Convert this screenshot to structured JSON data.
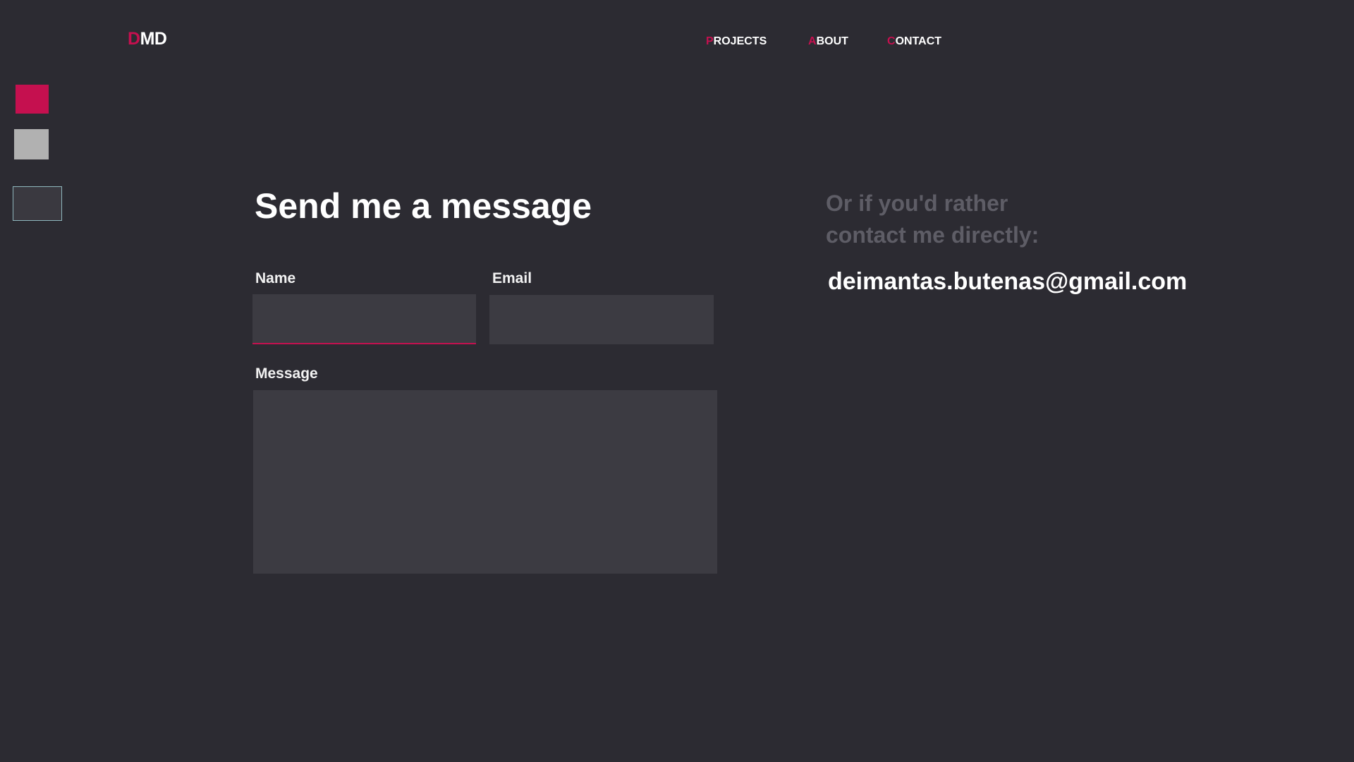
{
  "header": {
    "logo": {
      "first_letter": "D",
      "rest": "MD"
    },
    "nav": [
      {
        "first_letter": "P",
        "rest": "ROJECTS"
      },
      {
        "first_letter": "A",
        "rest": "BOUT"
      },
      {
        "first_letter": "C",
        "rest": "ONTACT"
      }
    ]
  },
  "theme_switcher": {
    "swatches": [
      {
        "name": "crimson",
        "color": "#c5104f"
      },
      {
        "name": "gray",
        "color": "#b1b1b1"
      },
      {
        "name": "dark",
        "color": "#3a3940",
        "selected": true
      }
    ]
  },
  "form": {
    "title": "Send me a message",
    "name_label": "Name",
    "name_value": "",
    "email_label": "Email",
    "email_value": "",
    "message_label": "Message",
    "message_value": ""
  },
  "contact": {
    "heading_line1": "Or if you'd rather",
    "heading_line2": "contact me directly:",
    "email": "deimantas.butenas@gmail.com"
  },
  "colors": {
    "background": "#2c2b32",
    "accent": "#c5104f",
    "input_background": "#3c3b42",
    "muted_text": "#5e5d66"
  }
}
